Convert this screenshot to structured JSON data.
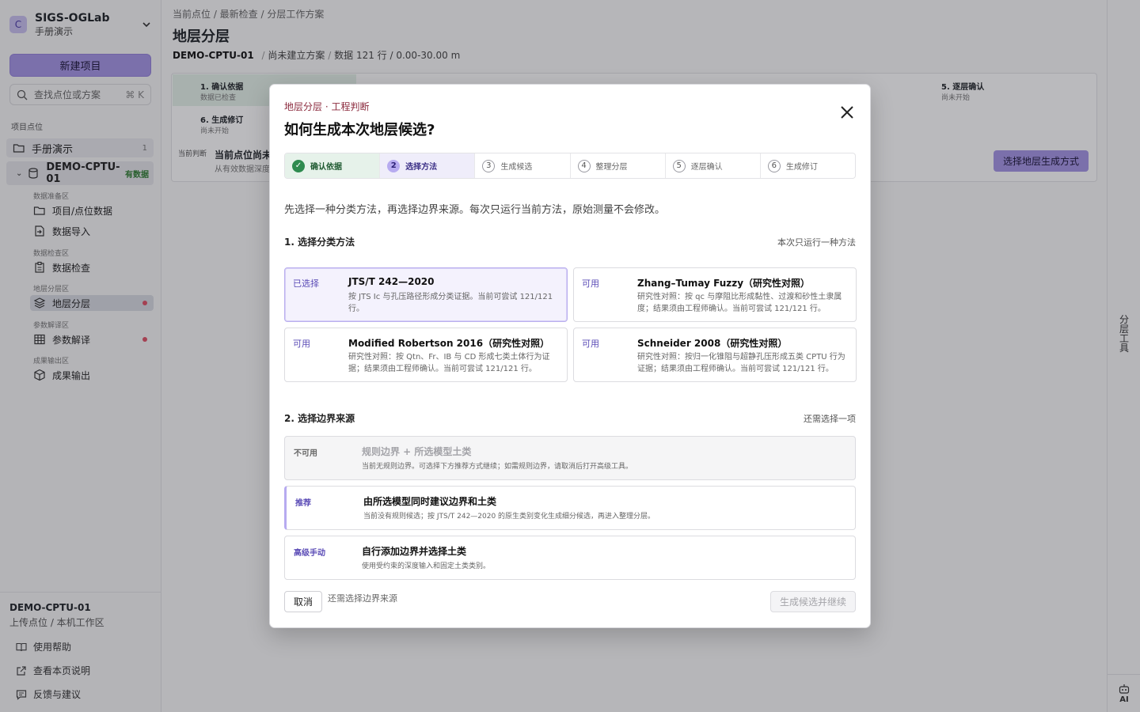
{
  "sidebar": {
    "workspace_initial": "C",
    "workspace_title": "SIGS-OGLab",
    "workspace_sub": "手册演示",
    "new_project": "新建项目",
    "search_placeholder": "查找点位或方案",
    "search_shortcut": "⌘ K",
    "section_label": "项目点位",
    "project": {
      "label": "手册演示",
      "count": "1"
    },
    "site": {
      "label_line1": "DEMO-CPTU-",
      "label_line2": "01",
      "badge": "有数据"
    },
    "groups": {
      "prep": "数据准备区",
      "check": "数据检查区",
      "strat": "地层分层区",
      "param": "参数解译区",
      "output": "成果输出区"
    },
    "nav": {
      "project_data": "项目/点位数据",
      "import": "数据导入",
      "check": "数据检查",
      "strat": "地层分层",
      "param": "参数解译",
      "output": "成果输出"
    },
    "footer": {
      "site": "DEMO-CPTU-01",
      "sub": "上传点位 / 本机工作区",
      "help": "使用帮助",
      "page_doc": "查看本页说明",
      "feedback": "反馈与建议"
    }
  },
  "main": {
    "breadcrumb": "当前点位 / 最新检查 / 分层工作方案",
    "title": "地层分层",
    "meta": {
      "site": "DEMO-CPTU-01",
      "plan": "尚未建立方案",
      "data": "数据 121 行 / 0.00-30.00 m"
    },
    "steps": [
      {
        "title": "1. 确认依据",
        "sub": "数据已检查"
      },
      {
        "title": "5. 逐层确认",
        "sub": "尚未开始"
      },
      {
        "title": "6. 生成修订",
        "sub": "尚未开始"
      }
    ],
    "current_label": "当前判断",
    "current_title": "当前点位尚未",
    "current_sub": "从有效数据深度",
    "choose_button": "选择地层生成方式"
  },
  "rail": {
    "tools": "分层工具",
    "ai": "AI"
  },
  "modal": {
    "kicker": "地层分层 · 工程判断",
    "title": "如何生成本次地层候选?",
    "steps": [
      {
        "num": "✓",
        "label": "确认依据",
        "state": "done"
      },
      {
        "num": "2",
        "label": "选择方法",
        "state": "current"
      },
      {
        "num": "3",
        "label": "生成候选",
        "state": "todo"
      },
      {
        "num": "4",
        "label": "整理分层",
        "state": "todo"
      },
      {
        "num": "5",
        "label": "逐层确认",
        "state": "todo"
      },
      {
        "num": "6",
        "label": "生成修订",
        "state": "todo"
      }
    ],
    "intro": "先选择一种分类方法，再选择边界来源。每次只运行当前方法，原始测量不会修改。",
    "methods_heading": "1. 选择分类方法",
    "methods_note": "本次只运行一种方法",
    "methods": [
      {
        "tag": "已选择",
        "title": "JTS/T 242—2020",
        "desc": "按 JTS Ic 与孔压路径形成分类证据。当前可尝试 121/121 行。"
      },
      {
        "tag": "可用",
        "title": "Zhang–Tumay Fuzzy（研究性对照）",
        "desc": "研究性对照：按 qc 与摩阻比形成黏性、过渡和砂性土隶属度；结果须由工程师确认。当前可尝试 121/121 行。"
      },
      {
        "tag": "可用",
        "title": "Modified Robertson 2016（研究性对照）",
        "desc": "研究性对照：按 Qtn、Fr、IB 与 CD 形成七类土体行为证据；结果须由工程师确认。当前可尝试 121/121 行。"
      },
      {
        "tag": "可用",
        "title": "Schneider 2008（研究性对照）",
        "desc": "研究性对照：按归一化锥阻与超静孔压形成五类 CPTU 行为证据；结果须由工程师确认。当前可尝试 121/121 行。"
      }
    ],
    "boundary_heading": "2. 选择边界来源",
    "boundary_note": "还需选择一项",
    "boundaries": [
      {
        "tag": "不可用",
        "title": "规则边界 + 所选模型土类",
        "desc": "当前无规则边界。可选择下方推荐方式继续；如需规则边界，请取消后打开高级工具。"
      },
      {
        "tag": "推荐",
        "title": "由所选模型同时建议边界和土类",
        "desc": "当前没有规则候选；按 JTS/T 242—2020 的原生类别变化生成细分候选，再进入整理分层。"
      },
      {
        "tag": "高级手动",
        "title": "自行添加边界并选择土类",
        "desc": "使用受约束的深度输入和固定土类类别。"
      }
    ],
    "cancel": "取消",
    "footnote": "还需选择边界来源",
    "submit": "生成候选并继续"
  },
  "colors": {
    "accent": "#a595e6",
    "done": "#2e8b4f",
    "kicker": "#8b2a3d"
  },
  "icons": [
    "folder-open-icon",
    "database-icon",
    "import-icon",
    "clipboard-icon",
    "layers-icon",
    "table-icon",
    "package-icon",
    "book-icon",
    "external-link-icon",
    "message-icon",
    "robot-icon",
    "close-icon",
    "search-icon",
    "chevron-down-icon"
  ]
}
